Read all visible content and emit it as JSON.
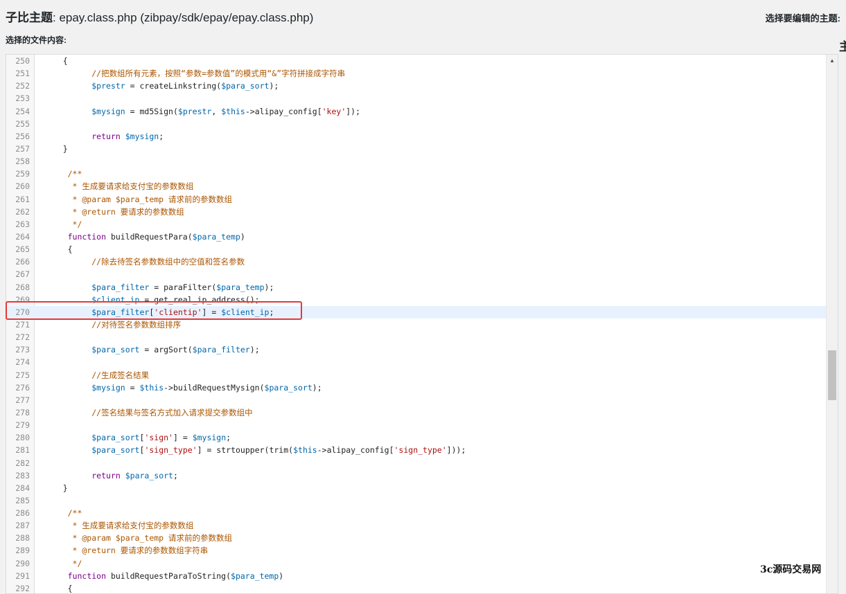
{
  "header": {
    "title_label": "子比主题",
    "file_title": ": epay.class.php (zibpay/sdk/epay/epay.class.php)",
    "right_label": "选择要编辑的主题:",
    "edge_char": "主"
  },
  "editor": {
    "content_label": "选择的文件内容:",
    "active_line": 270,
    "lines": [
      {
        "num": "250",
        "text": "    {"
      },
      {
        "num": "251",
        "text": "          //把数组所有元素，按照“参数=参数值”的模式用“&”字符拼接成字符串"
      },
      {
        "num": "252",
        "text": "          $prestr = createLinkstring($para_sort);"
      },
      {
        "num": "253",
        "text": ""
      },
      {
        "num": "254",
        "text": "          $mysign = md5Sign($prestr, $this->alipay_config['key']);"
      },
      {
        "num": "255",
        "text": ""
      },
      {
        "num": "256",
        "text": "          return $mysign;"
      },
      {
        "num": "257",
        "text": "    }"
      },
      {
        "num": "258",
        "text": ""
      },
      {
        "num": "259",
        "text": "     /**"
      },
      {
        "num": "260",
        "text": "      * 生成要请求给支付宝的参数数组"
      },
      {
        "num": "261",
        "text": "      * @param $para_temp 请求前的参数数组"
      },
      {
        "num": "262",
        "text": "      * @return 要请求的参数数组"
      },
      {
        "num": "263",
        "text": "      */"
      },
      {
        "num": "264",
        "text": "     function buildRequestPara($para_temp)"
      },
      {
        "num": "265",
        "text": "     {"
      },
      {
        "num": "266",
        "text": "          //除去待签名参数数组中的空值和签名参数"
      },
      {
        "num": "267",
        "text": ""
      },
      {
        "num": "268",
        "text": "          $para_filter = paraFilter($para_temp);"
      },
      {
        "num": "269",
        "text": "          $client_ip = get_real_ip_address();"
      },
      {
        "num": "270",
        "text": "          $para_filter['clientip'] = $client_ip;"
      },
      {
        "num": "271",
        "text": "          //对待签名参数数组排序"
      },
      {
        "num": "272",
        "text": ""
      },
      {
        "num": "273",
        "text": "          $para_sort = argSort($para_filter);"
      },
      {
        "num": "274",
        "text": ""
      },
      {
        "num": "275",
        "text": "          //生成签名结果"
      },
      {
        "num": "276",
        "text": "          $mysign = $this->buildRequestMysign($para_sort);"
      },
      {
        "num": "277",
        "text": ""
      },
      {
        "num": "278",
        "text": "          //签名结果与签名方式加入请求提交参数组中"
      },
      {
        "num": "279",
        "text": ""
      },
      {
        "num": "280",
        "text": "          $para_sort['sign'] = $mysign;"
      },
      {
        "num": "281",
        "text": "          $para_sort['sign_type'] = strtoupper(trim($this->alipay_config['sign_type']));"
      },
      {
        "num": "282",
        "text": ""
      },
      {
        "num": "283",
        "text": "          return $para_sort;"
      },
      {
        "num": "284",
        "text": "    }"
      },
      {
        "num": "285",
        "text": ""
      },
      {
        "num": "286",
        "text": "     /**"
      },
      {
        "num": "287",
        "text": "      * 生成要请求给支付宝的参数数组"
      },
      {
        "num": "288",
        "text": "      * @param $para_temp 请求前的参数数组"
      },
      {
        "num": "289",
        "text": "      * @return 要请求的参数数组字符串"
      },
      {
        "num": "290",
        "text": "      */"
      },
      {
        "num": "291",
        "text": "     function buildRequestParaToString($para_temp)"
      },
      {
        "num": "292",
        "text": "     {"
      }
    ]
  },
  "scrollbar": {
    "up_icon": "triangle-up-icon",
    "up_glyph": "▲"
  },
  "watermark": {
    "text": "3c源码交易网"
  },
  "colors": {
    "highlight_border": "#e53935",
    "active_line_bg": "#e8f2ff",
    "variable": "#0066aa",
    "string": "#aa1111",
    "keyword": "#770088",
    "comment": "#aa5500",
    "builtin": "#3300aa"
  }
}
